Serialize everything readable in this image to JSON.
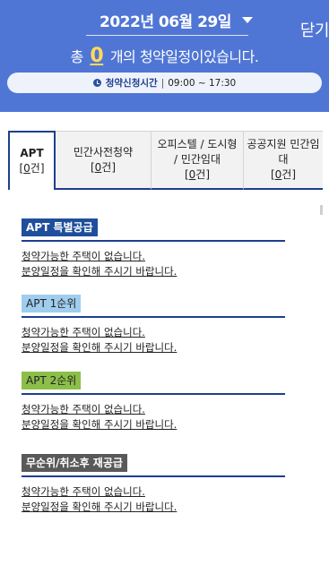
{
  "header": {
    "date": "2022년 06월 29일",
    "close_label": "닫기",
    "count_prefix": "총",
    "count": "0",
    "count_suffix": "개의 청약일정이있습니다.",
    "time_label": "청약신청시간",
    "time_separator": "|",
    "time_value": "09:00 ~ 17:30",
    "colors": {
      "background": "#5076d5",
      "count_highlight": "#ffd95c"
    }
  },
  "tabs": [
    {
      "label": "APT",
      "count_open": "[",
      "count": "0",
      "count_unit": "건",
      "count_close": "]",
      "active": true
    },
    {
      "label": "민간사전청약",
      "count_open": "[",
      "count": "0",
      "count_unit": "건",
      "count_close": "]",
      "active": false
    },
    {
      "label_line1": "오피스텔 / 도시형",
      "label_line2": "/ 민간임대",
      "count_open": "[",
      "count": "0",
      "count_unit": "건",
      "count_close": "]",
      "active": false
    },
    {
      "label_line1": "공공지원 민간임",
      "label_line2": "대",
      "count_open": "[",
      "count": "0",
      "count_unit": "건",
      "count_close": "]",
      "active": false
    }
  ],
  "sections": [
    {
      "title": "APT 특별공급",
      "line1": "청약가능한 주택이 없습니다.",
      "line2": "분양일정을 확인해 주시기 바랍니다.",
      "color": "#1f4f9c"
    },
    {
      "title": "APT 1순위",
      "line1": "청약가능한 주택이 없습니다.",
      "line2": "분양일정을 확인해 주시기 바랍니다.",
      "color": "#9fcdee"
    },
    {
      "title": "APT 2순위",
      "line1": "청약가능한 주택이 없습니다.",
      "line2": "분양일정을 확인해 주시기 바랍니다.",
      "color": "#8cbf4a"
    },
    {
      "title": "무순위/취소후 재공급",
      "line1": "청약가능한 주택이 없습니다.",
      "line2": "분양일정을 확인해 주시기 바랍니다.",
      "color": "#595959"
    }
  ],
  "icons": {
    "date": "calendar-icon",
    "dropdown": "chevron-down-icon",
    "time": "clock-icon"
  }
}
